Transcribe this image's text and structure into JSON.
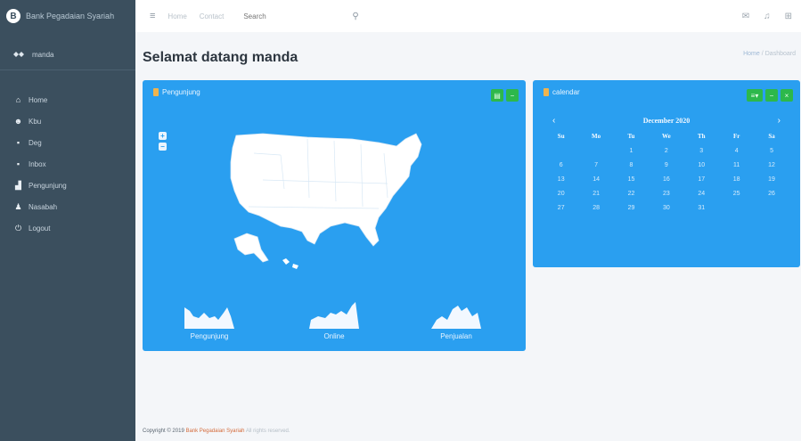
{
  "brand": {
    "logo_letter": "B",
    "name": "Bank Pegadaian Syariah"
  },
  "user": {
    "name": "manda"
  },
  "nav": {
    "items": [
      {
        "label": "Home",
        "icon": "home-icon"
      },
      {
        "label": "Kbu",
        "icon": "users-icon"
      },
      {
        "label": "Deg",
        "icon": "card-icon"
      },
      {
        "label": "Inbox",
        "icon": "card-icon"
      },
      {
        "label": "Pengunjung",
        "icon": "bar-chart-icon"
      },
      {
        "label": "Nasabah",
        "icon": "user-icon"
      },
      {
        "label": "Logout",
        "icon": "power-icon"
      }
    ]
  },
  "topbar": {
    "links": [
      "Home",
      "Contact"
    ],
    "search_placeholder": "Search"
  },
  "page": {
    "title": "Selamat datang manda"
  },
  "breadcrumb": {
    "home": "Home",
    "current": "Dashboard"
  },
  "visitors_card": {
    "title": "Pengunjung",
    "sparklines": [
      {
        "label": "Pengunjung"
      },
      {
        "label": "Online"
      },
      {
        "label": "Penjualan"
      }
    ]
  },
  "calendar_card": {
    "title": "calendar",
    "month": "December 2020",
    "prev": "‹",
    "next": "›",
    "weekdays": [
      "Su",
      "Mo",
      "Tu",
      "We",
      "Th",
      "Fr",
      "Sa"
    ],
    "weeks": [
      [
        "",
        "",
        "1",
        "2",
        "3",
        "4",
        "5"
      ],
      [
        "6",
        "7",
        "8",
        "9",
        "10",
        "11",
        "12"
      ],
      [
        "13",
        "14",
        "15",
        "16",
        "17",
        "18",
        "19"
      ],
      [
        "20",
        "21",
        "22",
        "23",
        "24",
        "25",
        "26"
      ],
      [
        "27",
        "28",
        "29",
        "30",
        "31",
        "",
        ""
      ]
    ]
  },
  "footer": {
    "prefix": "Copyright © 2019",
    "brand": "Bank Pegadaian Syariah",
    "suffix": "All rights reserved."
  },
  "colors": {
    "sidebar": "#3b4f5e",
    "card_blue": "#2a9ff0",
    "tool_green": "#2db84b",
    "title_icon": "#f0b44d"
  }
}
